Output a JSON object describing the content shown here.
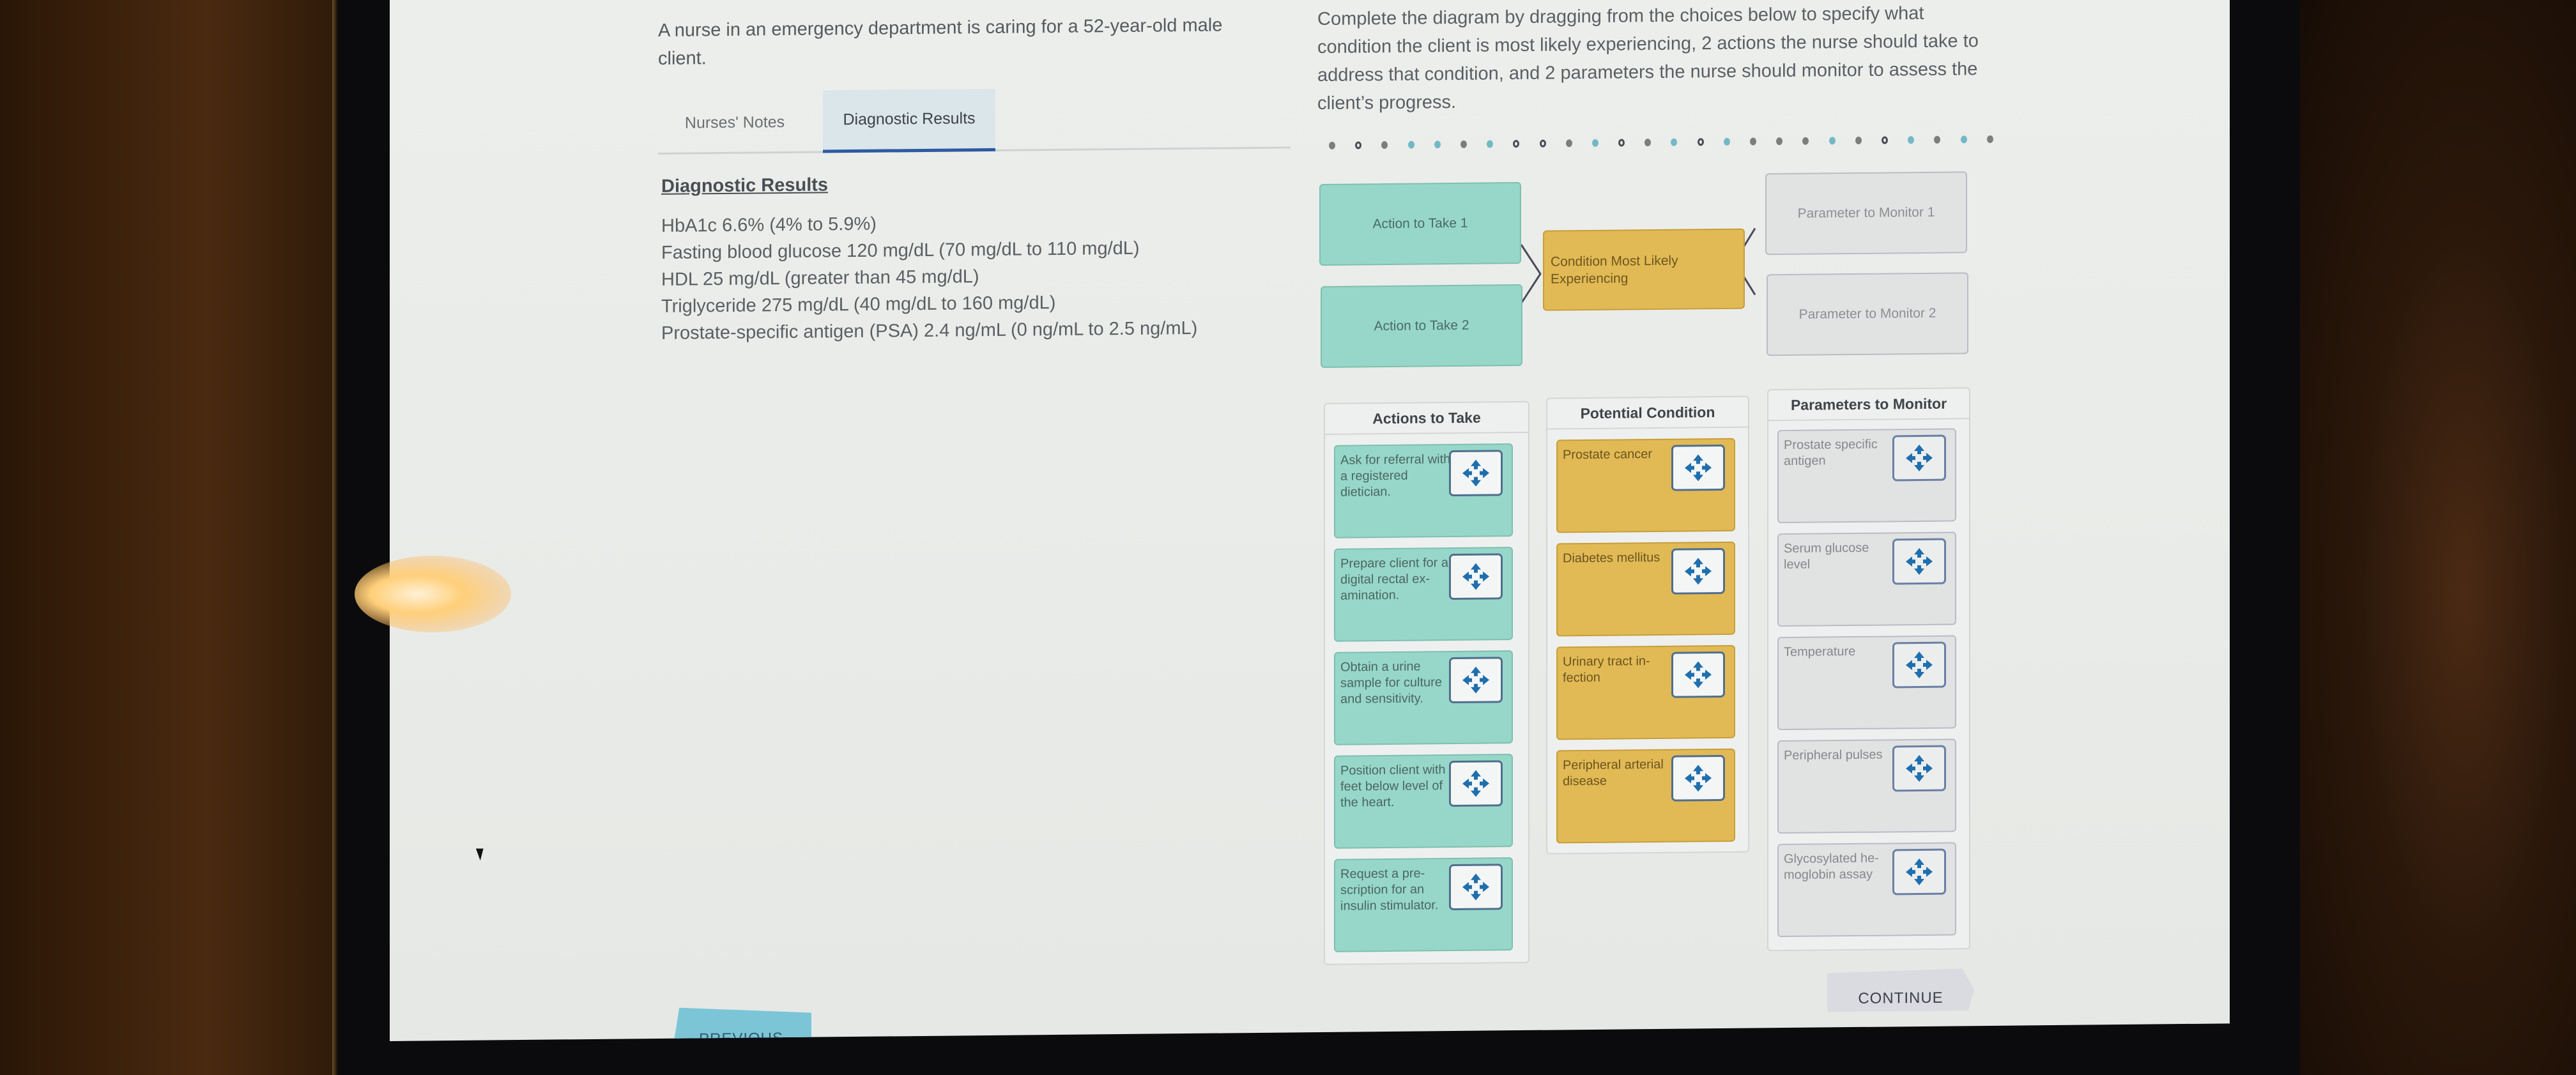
{
  "scenario": {
    "text": "A nurse in an emergency department is caring for a 52-year-old male client."
  },
  "tabs": [
    {
      "label": "Nurses' Notes",
      "active": false
    },
    {
      "label": "Diagnostic Results",
      "active": true
    }
  ],
  "diagnostic_results": {
    "title": "Diagnostic Results",
    "lines": [
      "HbA1c 6.6% (4% to 5.9%)",
      "Fasting blood glucose 120 mg/dL (70 mg/dL to 110 mg/dL)",
      "HDL 25 mg/dL (greater than 45 mg/dL)",
      "Triglyceride 275 mg/dL (40 mg/dL to 160 mg/dL)",
      "Prostate-specific antigen (PSA) 2.4 ng/mL (0 ng/mL to 2.5 ng/mL)"
    ]
  },
  "instructions": {
    "text": "Complete the diagram by dragging from the choices below to specify what condition the client is most likely experiencing, 2 actions the nurse should take to address that condition, and 2 parameters the nurse should monitor to assess the client’s progress."
  },
  "progress_dots": [
    "g",
    "o",
    "g",
    "t",
    "t",
    "g",
    "t",
    "o",
    "o",
    "g",
    "t",
    "o",
    "g",
    "t",
    "o",
    "t",
    "g",
    "g",
    "g",
    "t",
    "g",
    "o",
    "t",
    "g",
    "t",
    "g"
  ],
  "diagram": {
    "action_slot_1": "Action to Take 1",
    "action_slot_2": "Action to Take 2",
    "condition_slot": "Condition Most Likely Experiencing",
    "parameter_slot_1": "Parameter to Monitor 1",
    "parameter_slot_2": "Parameter to Monitor 2"
  },
  "columns": {
    "actions": {
      "title": "Actions to Take",
      "items": [
        "Ask for referral with a registered dietician.",
        "Prepare client for a digital rectal ex-amination.",
        "Obtain a urine sample for culture and sensitivity.",
        "Position client with feet below level of the heart.",
        "Request a pre-scription for an insulin stimulator."
      ]
    },
    "conditions": {
      "title": "Potential Condition",
      "items": [
        "Prostate cancer",
        "Diabetes mellitus",
        "Urinary tract in-fection",
        "Peripheral arterial disease"
      ]
    },
    "parameters": {
      "title": "Parameters to Monitor",
      "items": [
        "Prostate specific antigen",
        "Serum glucose level",
        "Temperature",
        "Peripheral pulses",
        "Glycosylated he-moglobin assay"
      ]
    }
  },
  "icons": {
    "drag_handle": "move-arrows-icon"
  },
  "colors": {
    "action": "#97d7c9",
    "condition": "#e1ba55",
    "parameter": "#e1e2e2",
    "handle_arrow": "#1f6fae",
    "active_tab_underline": "#2e5aa0"
  },
  "navigation": {
    "previous": "PREVIOUS",
    "continue": "CONTINUE"
  }
}
